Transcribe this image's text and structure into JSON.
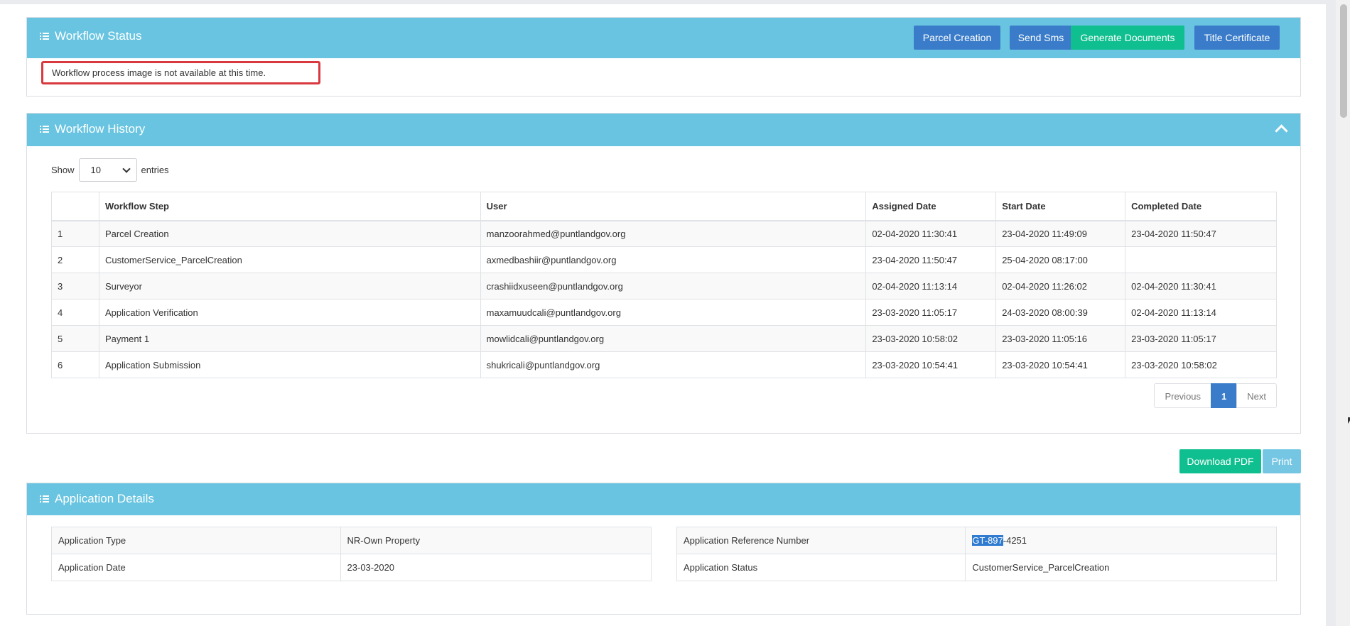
{
  "workflow_status": {
    "title": "Workflow Status",
    "buttons": {
      "parcel_creation": "Parcel Creation",
      "send_sms": "Send Sms",
      "generate_documents": "Generate Documents",
      "title_certificate": "Title Certificate"
    },
    "notice": "Workflow process image is not available at this time."
  },
  "workflow_history": {
    "title": "Workflow History",
    "show_label": "Show",
    "entries_label": "entries",
    "page_length": "10",
    "columns": [
      "",
      "Workflow Step",
      "User",
      "Assigned Date",
      "Start Date",
      "Completed Date"
    ],
    "rows": [
      [
        "1",
        "Parcel Creation",
        "manzoorahmed@puntlandgov.org",
        "02-04-2020 11:30:41",
        "23-04-2020 11:49:09",
        "23-04-2020 11:50:47"
      ],
      [
        "2",
        "CustomerService_ParcelCreation",
        "axmedbashiir@puntlandgov.org",
        "23-04-2020 11:50:47",
        "25-04-2020 08:17:00",
        ""
      ],
      [
        "3",
        "Surveyor",
        "crashiidxuseen@puntlandgov.org",
        "02-04-2020 11:13:14",
        "02-04-2020 11:26:02",
        "02-04-2020 11:30:41"
      ],
      [
        "4",
        "Application Verification",
        "maxamuudcali@puntlandgov.org",
        "23-03-2020 11:05:17",
        "24-03-2020 08:00:39",
        "02-04-2020 11:13:14"
      ],
      [
        "5",
        "Payment 1",
        "mowlidcali@puntlandgov.org",
        "23-03-2020 10:58:02",
        "23-03-2020 11:05:16",
        "23-03-2020 11:05:17"
      ],
      [
        "6",
        "Application Submission",
        "shukricali@puntlandgov.org",
        "23-03-2020 10:54:41",
        "23-03-2020 10:54:41",
        "23-03-2020 10:58:02"
      ]
    ],
    "pager": {
      "previous": "Previous",
      "current": "1",
      "next": "Next"
    }
  },
  "actions": {
    "download_pdf": "Download PDF",
    "print": "Print"
  },
  "application_details": {
    "title": "Application Details",
    "left": [
      {
        "label": "Application Type",
        "value": "NR-Own Property"
      },
      {
        "label": "Application Date",
        "value": "23-03-2020"
      }
    ],
    "right": {
      "ref_label": "Application Reference Number",
      "ref_highlighted": "GT-897",
      "ref_rest": "-4251",
      "status_label": "Application Status",
      "status_value": "CustomerService_ParcelCreation"
    }
  }
}
